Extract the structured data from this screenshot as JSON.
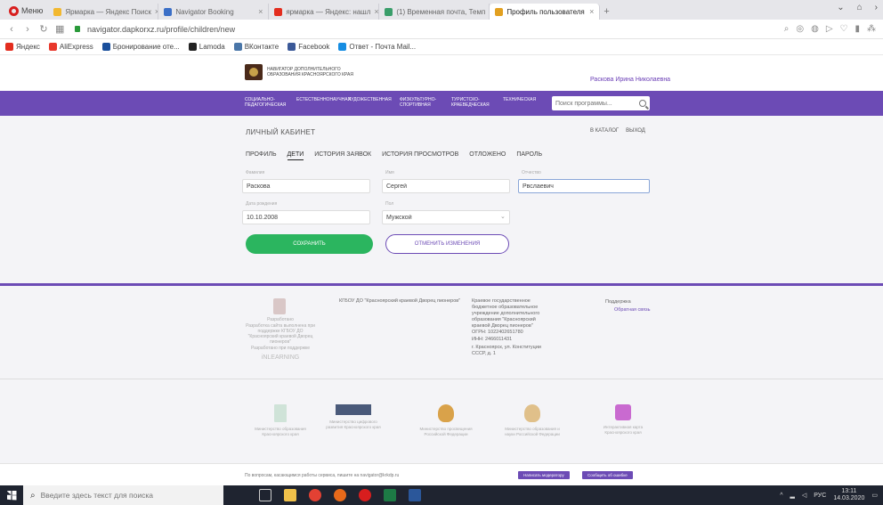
{
  "browser": {
    "menu_label": "Меню",
    "tabs": [
      {
        "label": "Ярмарка — Яндекс Поиск",
        "color": "#f2b830",
        "active": false
      },
      {
        "label": "Navigator Booking",
        "color": "#3b6fc7",
        "active": false
      },
      {
        "label": "ярмарка — Яндекс: нашл",
        "color": "#e32d1e",
        "active": false
      },
      {
        "label": "(1) Временная почта, Темп",
        "color": "#3a9e6a",
        "active": false
      },
      {
        "label": "Профиль пользователя",
        "color": "#e2a020",
        "active": true
      }
    ],
    "url": "navigator.dapkorxz.ru/profile/children/new",
    "bookmarks": [
      {
        "label": "Яндекс",
        "color": "#e32d1e"
      },
      {
        "label": "AliExpress",
        "color": "#e8382c"
      },
      {
        "label": "Бронирование оте...",
        "color": "#1a4f9c"
      },
      {
        "label": "Lamoda",
        "color": "#222222"
      },
      {
        "label": "ВКонтакте",
        "color": "#4a76a8"
      },
      {
        "label": "Facebook",
        "color": "#3b5998"
      },
      {
        "label": "Ответ - Почта Mail...",
        "color": "#168de2"
      }
    ]
  },
  "site": {
    "logo_text": "НАВИГАТОР ДОПОЛНИТЕЛЬНОГО ОБРАЗОВАНИЯ КРАСНОЯРСКОГО КРАЯ",
    "user_name": "Раскова Ирина Николаевна",
    "menu": [
      "Социально-педагогическая",
      "Естественнонаучная",
      "Художественная",
      "Физкультурно-спортивная",
      "Туристско-краеведческая",
      "Техническая"
    ],
    "search_placeholder": "Поиск программы...",
    "cabinet_title": "ЛИЧНЫЙ КАБИНЕТ",
    "catalog_link": "В КАТАЛОГ",
    "logout_link": "ВЫХОД",
    "profile_tabs": [
      {
        "label": "Профиль",
        "active": false
      },
      {
        "label": "Дети",
        "active": true
      },
      {
        "label": "История заявок",
        "active": false
      },
      {
        "label": "История просмотров",
        "active": false
      },
      {
        "label": "Отложено",
        "active": false
      },
      {
        "label": "Пароль",
        "active": false
      }
    ],
    "form": {
      "surname_label": "Фамилия",
      "surname_value": "Раскова",
      "name_label": "Имя",
      "name_value": "Сергей",
      "patronymic_label": "Отчество",
      "patronymic_value": "Рвслаевич",
      "birthdate_label": "Дата рождения",
      "birthdate_value": "10.10.2008",
      "gender_label": "Пол",
      "gender_value": "Мужской"
    },
    "save_label": "Сохранить",
    "cancel_label": "Отменить изменения",
    "footer": {
      "org_label": "Разработано",
      "org_caption": "Разработка сайта выполнена при поддержке КГБОУ ДО \"Красноярский краевой Дворец пионеров\"",
      "ilearning": "iNLEARNING",
      "ilearning_caption": "Разработано при поддержке",
      "operator": "КГБОУ ДО \"Красноярский краевой Дворец пионеров\"",
      "address_title": "Краевое государственное бюджетное образовательное учреждение дополнительного образования \"Красноярский краевой Дворец пионеров\"",
      "phone": "ОГРН: 1022402651780",
      "inn": "ИНН: 2466011431",
      "address": "г. Красноярск, ул. Конституции СССР, д. 1",
      "support_label": "Поддержка",
      "support_link": "Обратная связь"
    },
    "partners": [
      {
        "caption": "Министерство образования Красноярского края"
      },
      {
        "caption": "Министерство цифрового развития Красноярского края"
      },
      {
        "caption": "Министерство просвещения Российской Федерации"
      },
      {
        "caption": "Министерство образования и науки Российской Федерации"
      },
      {
        "caption": "Интерактивная карта Красноярского края"
      }
    ],
    "bottom_text": "По вопросам, касающимся работы сервиса, пишите на navigator@krkdp.ru",
    "bottom_btn1": "Написать модератору",
    "bottom_btn2": "Сообщить об ошибке"
  },
  "taskbar": {
    "search_placeholder": "Введите здесь текст для поиска",
    "lang": "РУС",
    "time": "13:11",
    "date": "14.03.2020"
  }
}
